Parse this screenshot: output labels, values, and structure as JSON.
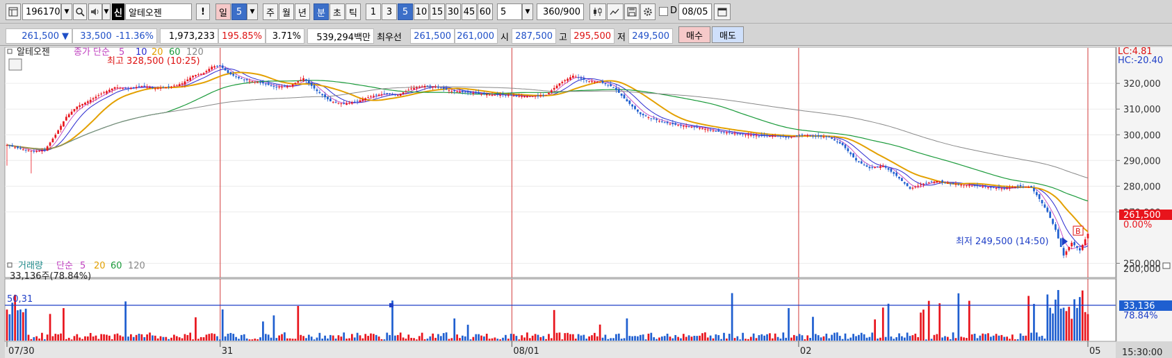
{
  "toolbar": {
    "code": "196170",
    "sin_label": "신",
    "stock_name": "알테오젠",
    "excl": "!",
    "il": "일",
    "il_value": "5",
    "periods": [
      "주",
      "월",
      "년"
    ],
    "bun": "분",
    "cho": "초",
    "tick": "틱",
    "intervals": [
      "1",
      "3",
      "5",
      "10",
      "15",
      "30",
      "45",
      "60"
    ],
    "selected_interval": "5",
    "interval_value": "5",
    "count": "360/900",
    "d_label": "D",
    "date": "08/05"
  },
  "quote": {
    "price": "261,500",
    "arrow": "▼",
    "change": "33,500",
    "change_pct": "-11.36%",
    "volume": "1,973,233",
    "vol_ratio": "195.85%",
    "turnover": "3.71%",
    "trade_value": "539,294백만",
    "best_label": "최우선",
    "best_ask": "261,500",
    "best_bid": "261,000",
    "open_label": "시",
    "open": "287,500",
    "high_label": "고",
    "high": "295,500",
    "low_label": "저",
    "low": "249,500",
    "buy_label": "매수",
    "sell_label": "매도"
  },
  "chart_data": {
    "type": "candlestick",
    "legend_price": {
      "name": "알테오젠",
      "series_label": "종가 단순",
      "periods": [
        "5",
        "10",
        "20",
        "60",
        "120"
      ]
    },
    "legend_volume": {
      "name": "거래량",
      "series_label": "단순",
      "periods": [
        "5",
        "20",
        "60",
        "120"
      ]
    },
    "max_annotation": "최고 328,500 (10:25)",
    "min_annotation": "최저 249,500 (14:50)",
    "b_marker": "B",
    "lc": "LC:4.81",
    "hc": "HC:-20.40",
    "y_ticks": [
      "320,000",
      "310,000",
      "300,000",
      "290,000",
      "280,000",
      "270,000",
      "250,000"
    ],
    "last_price_tag": "261,500",
    "last_pct": "0.00%",
    "ylim": [
      245000,
      333000
    ],
    "volume_ticks": [
      "200,000"
    ],
    "volume_last_tag": "33,136",
    "volume_last_pct": "78.84%",
    "volume_info": "33,136주(78.84%)",
    "volume_hline_label": "50,31",
    "x_labels": [
      "07/30",
      "31",
      "08/01",
      "02",
      "05"
    ],
    "time_label": "15:30:00",
    "close_path": [
      [
        0,
        296000
      ],
      [
        5,
        294500
      ],
      [
        10,
        293500
      ],
      [
        14,
        294000
      ],
      [
        18,
        300000
      ],
      [
        22,
        307000
      ],
      [
        26,
        311000
      ],
      [
        30,
        313000
      ],
      [
        35,
        316000
      ],
      [
        40,
        318500
      ],
      [
        45,
        318000
      ],
      [
        50,
        319000
      ],
      [
        55,
        318000
      ],
      [
        60,
        318500
      ],
      [
        65,
        320000
      ],
      [
        69,
        323000
      ],
      [
        73,
        324000
      ],
      [
        76,
        326500
      ],
      [
        79,
        327000
      ],
      [
        82,
        324000
      ],
      [
        86,
        322000
      ],
      [
        90,
        321000
      ],
      [
        95,
        320000
      ],
      [
        100,
        318500
      ],
      [
        105,
        319000
      ],
      [
        110,
        322000
      ],
      [
        115,
        317000
      ],
      [
        120,
        313000
      ],
      [
        125,
        312000
      ],
      [
        130,
        313000
      ],
      [
        135,
        315000
      ],
      [
        140,
        316000
      ],
      [
        145,
        315500
      ],
      [
        150,
        318000
      ],
      [
        155,
        319000
      ],
      [
        160,
        318500
      ],
      [
        165,
        317000
      ],
      [
        170,
        316500
      ],
      [
        175,
        316000
      ],
      [
        180,
        315500
      ],
      [
        185,
        315500
      ],
      [
        190,
        315000
      ],
      [
        195,
        315000
      ],
      [
        200,
        315500
      ],
      [
        205,
        320000
      ],
      [
        210,
        323000
      ],
      [
        215,
        321000
      ],
      [
        220,
        320500
      ],
      [
        225,
        318500
      ],
      [
        230,
        313000
      ],
      [
        235,
        308000
      ],
      [
        240,
        306000
      ],
      [
        245,
        304500
      ],
      [
        250,
        303500
      ],
      [
        255,
        303000
      ],
      [
        260,
        302000
      ],
      [
        265,
        301000
      ],
      [
        270,
        300500
      ],
      [
        275,
        300000
      ],
      [
        280,
        299500
      ],
      [
        285,
        299500
      ],
      [
        290,
        299000
      ],
      [
        295,
        300000
      ],
      [
        300,
        299500
      ],
      [
        305,
        299000
      ],
      [
        310,
        296000
      ],
      [
        315,
        290000
      ],
      [
        320,
        287000
      ],
      [
        325,
        288000
      ],
      [
        330,
        284000
      ],
      [
        335,
        279000
      ],
      [
        340,
        281000
      ],
      [
        345,
        282000
      ],
      [
        350,
        281000
      ],
      [
        355,
        280500
      ],
      [
        360,
        280000
      ],
      [
        365,
        279500
      ],
      [
        370,
        279000
      ],
      [
        375,
        280000
      ],
      [
        380,
        279500
      ],
      [
        383,
        275000
      ],
      [
        386,
        270000
      ],
      [
        389,
        263000
      ],
      [
        392,
        253000
      ],
      [
        395,
        258000
      ],
      [
        398,
        255000
      ],
      [
        401,
        261500
      ]
    ]
  }
}
